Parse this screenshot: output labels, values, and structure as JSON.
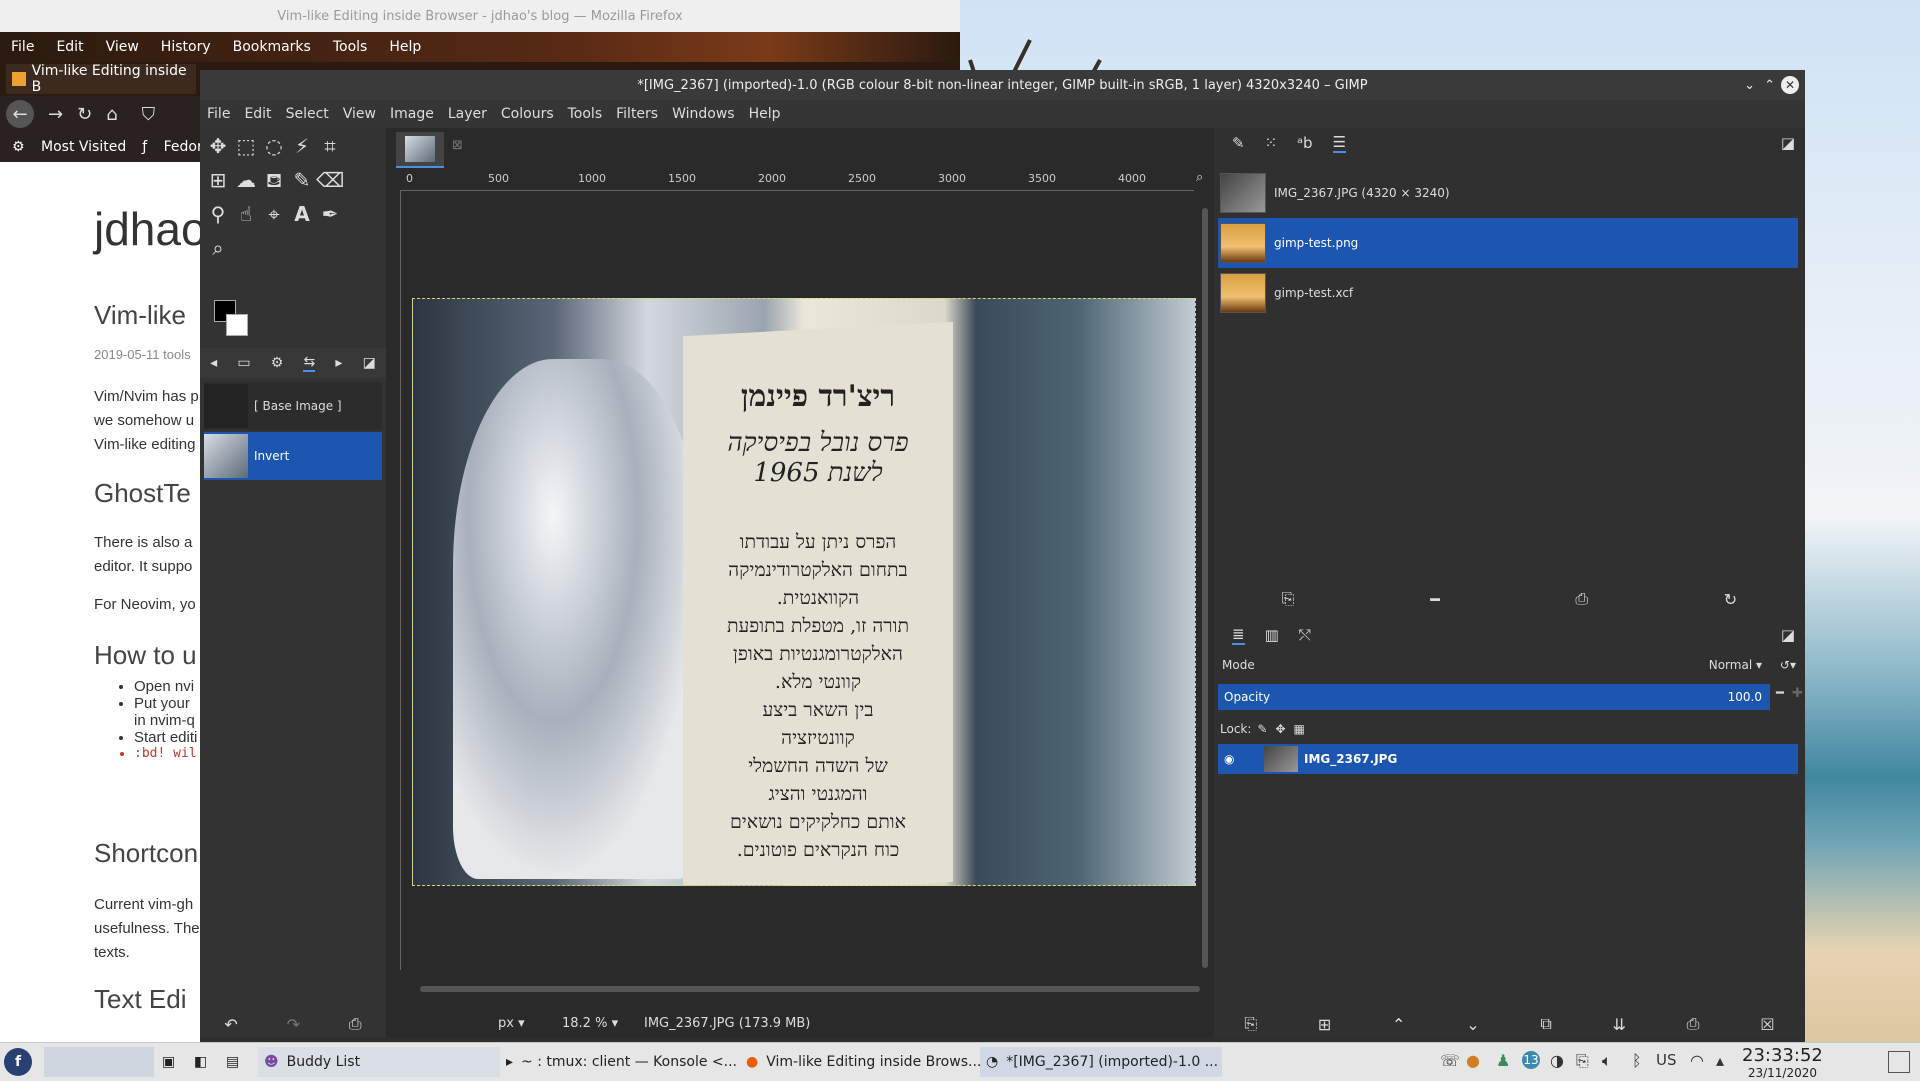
{
  "firefox": {
    "window_title": "Vim-like Editing inside Browser - jdhao's blog — Mozilla Firefox",
    "menu": [
      "File",
      "Edit",
      "View",
      "History",
      "Bookmarks",
      "Tools",
      "Help"
    ],
    "tab_title": "Vim-like Editing inside B",
    "bookmarks": [
      "Most Visited",
      "Fedora D"
    ],
    "blog": {
      "site_title": "jdhao",
      "post_title": "Vim-like",
      "meta": "2019-05-11 tools",
      "para1": [
        "Vim/Nvim has p",
        "we somehow u",
        "Vim-like editing"
      ],
      "h_ghost": "GhostTe",
      "para2": [
        "There is also a",
        "editor. It suppo"
      ],
      "para3": "For Neovim, yo",
      "h_howto": "How to u",
      "list": [
        "Open nvi",
        "Put your",
        "in nvim-q",
        "Start editi",
        ":bd! wil"
      ],
      "h_short": "Shortcon",
      "para4": [
        "Current vim-gh",
        "usefulness. The",
        "texts."
      ],
      "h_text": "Text Edi"
    }
  },
  "gimp": {
    "window_title": "*[IMG_2367] (imported)-1.0 (RGB colour 8-bit non-linear integer, GIMP built-in sRGB, 1 layer) 4320x3240 – GIMP",
    "menu": [
      "File",
      "Edit",
      "Select",
      "View",
      "Image",
      "Layer",
      "Colours",
      "Tools",
      "Filters",
      "Windows",
      "Help"
    ],
    "ruler_labels": [
      "0",
      "500",
      "1000",
      "1500",
      "2000",
      "2500",
      "3000",
      "3500",
      "4000"
    ],
    "undo_history": {
      "items": [
        {
          "label": "[ Base Image ]"
        },
        {
          "label": "Invert"
        }
      ]
    },
    "status": {
      "unit": "px",
      "zoom": "18.2 %",
      "info": "IMG_2367.JPG (173.9 MB)"
    },
    "images_panel": {
      "items": [
        {
          "label": "IMG_2367.JPG (4320 × 3240)"
        },
        {
          "label": "gimp-test.png"
        },
        {
          "label": "gimp-test.xcf"
        }
      ]
    },
    "layers_panel": {
      "mode_label": "Mode",
      "mode_value": "Normal",
      "opacity_label": "Opacity",
      "opacity_value": "100.0",
      "lock_label": "Lock:",
      "layer_name": "IMG_2367.JPG"
    },
    "canvas_text": {
      "line1": "ריצ'רד פיינמן",
      "line2": "פרס נובל בפיסיקה",
      "line3": "לשנת 1965",
      "body": [
        "הפרס ניתן על עבודתו",
        "בתחום האלקטרודינמיקה",
        "הקוואנטית.",
        "תורה זו, מטפלת בתופעת",
        "האלקטרומגנטיות באופן",
        "קוונטי מלא.",
        "בין השאר ביצע",
        "קוונטיזציה",
        "של השדה החשמלי",
        "והמגנטי והציג",
        "אותם כחלקיקים נושאים",
        "כוח הנקראים פוטונים."
      ]
    }
  },
  "taskbar": {
    "tasks": [
      "Buddy List",
      "~ : tmux: client — Konsole <...",
      "Vim-like Editing inside Brows...",
      "*[IMG_2367] (imported)-1.0 ..."
    ],
    "tray_lang": "US",
    "time": "23:33:52",
    "date": "23/11/2020",
    "badge": "13"
  }
}
